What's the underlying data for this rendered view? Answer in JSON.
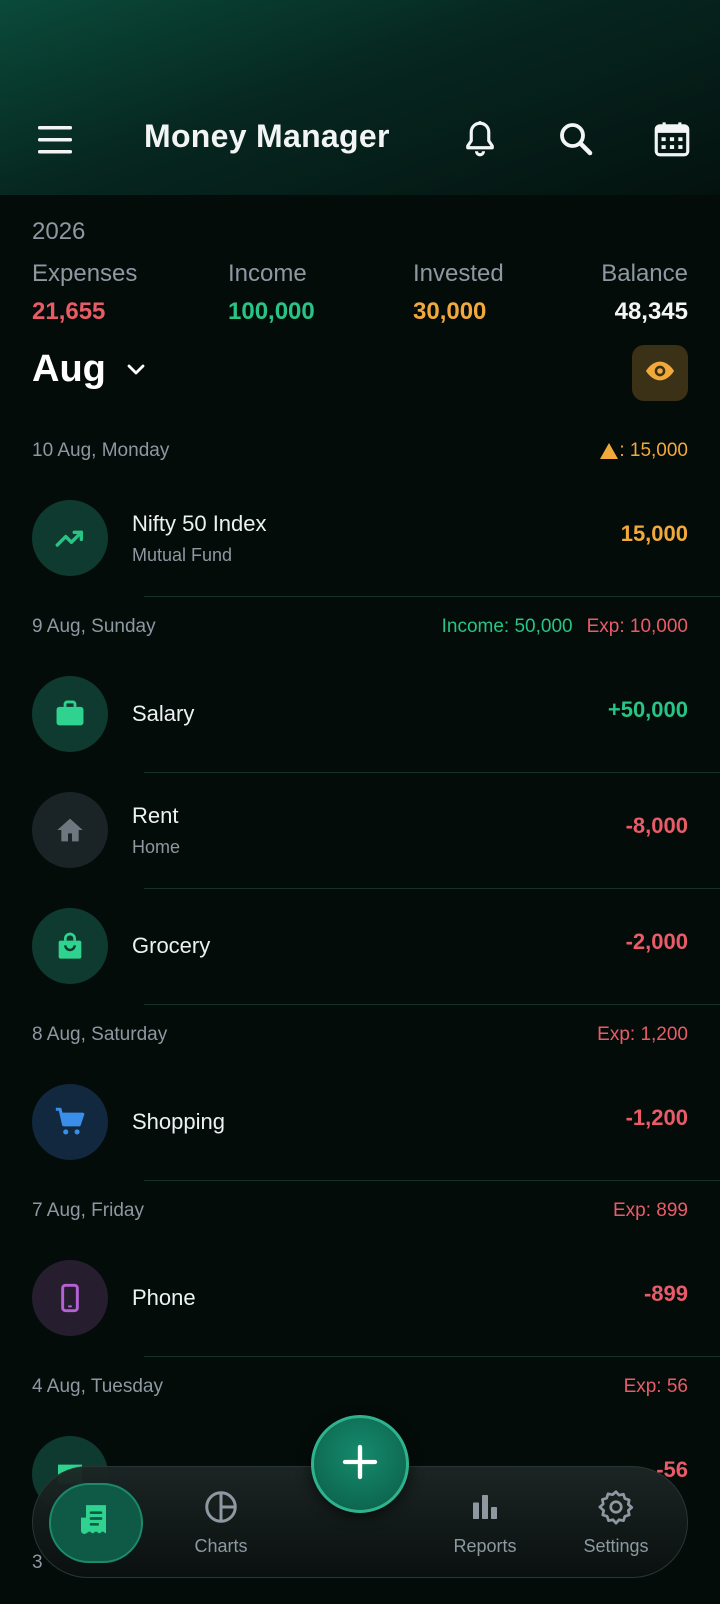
{
  "app": {
    "title": "Money Manager"
  },
  "icons": {
    "menu": "menu-icon",
    "bell": "bell-icon",
    "search": "search-icon",
    "calendar": "calendar-icon",
    "eye": "eye-icon",
    "chevron": "chevron-down-icon"
  },
  "colors": {
    "expense": "#ea5b68",
    "income": "#27c486",
    "invested": "#f2a93b",
    "balance": "#f4f6f6",
    "accent": "#0e5a46"
  },
  "summary": {
    "year": "2026",
    "expenses_label": "Expenses",
    "expenses_value": "21,655",
    "income_label": "Income",
    "income_value": "100,000",
    "invested_label": "Invested",
    "invested_value": "30,000",
    "balance_label": "Balance",
    "balance_value": "48,345"
  },
  "month": {
    "label": "Aug"
  },
  "days": [
    {
      "date": "10 Aug, Monday",
      "invest_total": ": 15,000",
      "transactions": [
        {
          "name": "Nifty 50 Index",
          "sub": "Mutual Fund",
          "amount": "15,000",
          "icon": "trending-up-icon"
        }
      ]
    },
    {
      "date": "9 Aug, Sunday",
      "income_total": "Income: 50,000",
      "expense_total": "Exp: 10,000",
      "transactions": [
        {
          "name": "Salary",
          "amount": "+50,000",
          "icon": "briefcase-icon"
        },
        {
          "name": "Rent",
          "sub": "Home",
          "amount": "-8,000",
          "icon": "home-icon"
        },
        {
          "name": "Grocery",
          "amount": "-2,000",
          "icon": "shopping-bag-icon"
        }
      ]
    },
    {
      "date": "8 Aug, Saturday",
      "expense_total": "Exp: 1,200",
      "transactions": [
        {
          "name": "Shopping",
          "amount": "-1,200",
          "icon": "cart-icon"
        }
      ]
    },
    {
      "date": "7 Aug, Friday",
      "expense_total": "Exp: 899",
      "transactions": [
        {
          "name": "Phone",
          "amount": "-899",
          "icon": "phone-icon"
        }
      ]
    },
    {
      "date": "4 Aug, Tuesday",
      "expense_total": "Exp: 56",
      "transactions": [
        {
          "name": "",
          "amount": "-56",
          "icon": "ticket-icon"
        }
      ]
    },
    {
      "date": "3",
      "expense_total": "",
      "transactions": []
    }
  ],
  "nav": {
    "charts": "Charts",
    "reports": "Reports",
    "settings": "Settings"
  }
}
